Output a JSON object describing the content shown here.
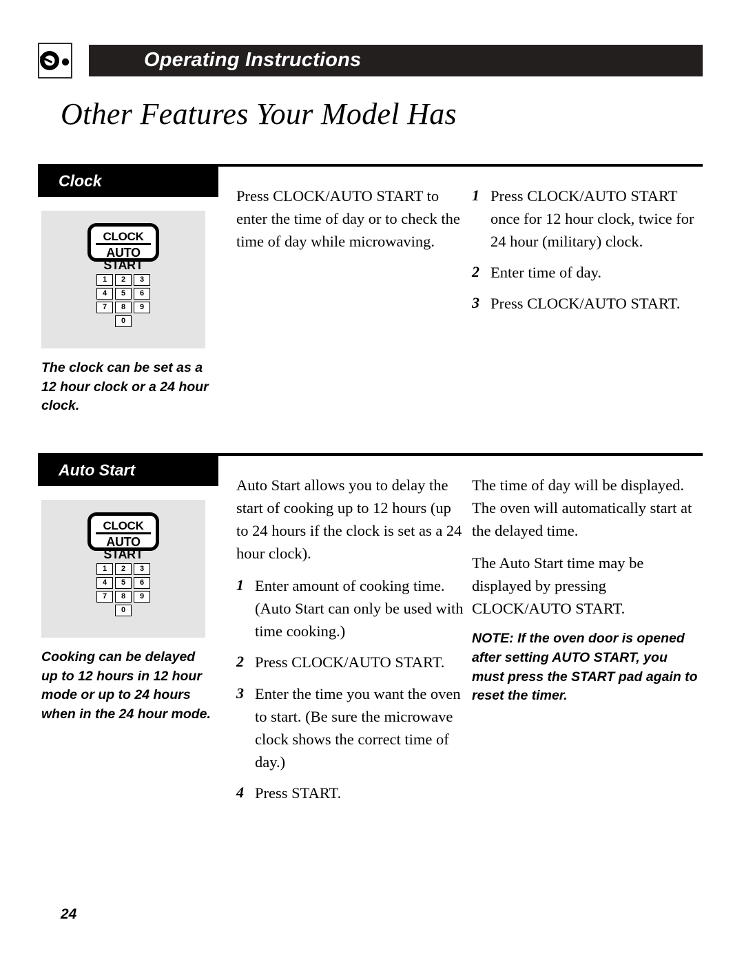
{
  "header": {
    "icon": "control-knob-icon",
    "band_title": "Operating Instructions"
  },
  "page_title": "Other Features Your Model Has",
  "page_number": "24",
  "control_pad": {
    "line1": "CLOCK",
    "line2": "AUTO START",
    "keypad_rows": [
      [
        "1",
        "2",
        "3"
      ],
      [
        "4",
        "5",
        "6"
      ],
      [
        "7",
        "8",
        "9"
      ]
    ],
    "keypad_zero": "0"
  },
  "sections": [
    {
      "id": "clock",
      "tab_label": "Clock",
      "side_caption": "The clock can be set as a 12 hour clock or a 24 hour clock.",
      "middle": {
        "paragraphs": [
          "Press CLOCK/AUTO START to enter the time of day or to check the time of day while microwaving."
        ]
      },
      "right": {
        "steps": [
          {
            "num": "1",
            "text": "Press CLOCK/AUTO START once for 12 hour clock, twice for 24 hour (military) clock."
          },
          {
            "num": "2",
            "text": "Enter time of day."
          },
          {
            "num": "3",
            "text": "Press CLOCK/AUTO START."
          }
        ]
      }
    },
    {
      "id": "auto-start",
      "tab_label": "Auto Start",
      "side_caption": "Cooking can be delayed up to 12 hours in 12 hour mode or up to 24 hours when in the 24 hour mode.",
      "middle": {
        "paragraphs": [
          "Auto Start allows you to delay the start of cooking up to 12 hours (up to 24 hours if the clock is set as a 24 hour clock)."
        ],
        "steps": [
          {
            "num": "1",
            "text": "Enter amount of cooking time. (Auto Start can only be used with time cooking.)"
          },
          {
            "num": "2",
            "text": "Press CLOCK/AUTO START."
          },
          {
            "num": "3",
            "text": "Enter the time you want the oven to start. (Be sure the microwave clock shows the correct time of day.)"
          },
          {
            "num": "4",
            "text": "Press START."
          }
        ]
      },
      "right": {
        "paragraphs": [
          "The time of day will be displayed. The oven will automatically start at the delayed time.",
          "The Auto Start time may be displayed by pressing CLOCK/AUTO START."
        ],
        "note": "NOTE: If the oven door is opened after setting AUTO START, you must press the START pad again to reset the timer."
      }
    }
  ],
  "colors": {
    "ink": "#000000",
    "header_band": "#231f1f",
    "panel_gray": "#e4e4e4",
    "paper": "#ffffff"
  }
}
